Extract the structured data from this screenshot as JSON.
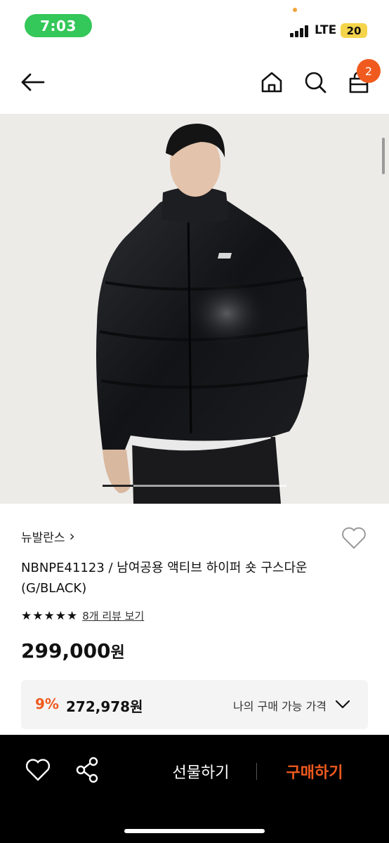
{
  "status_bar": {
    "time": "7:03",
    "network": "LTE",
    "battery": "20"
  },
  "header": {
    "cart_count": "2"
  },
  "product": {
    "brand": "뉴발란스",
    "brand_chevron": "›",
    "title": "NBNPE41123 / 남여공용 액티브 하이퍼 숏 구스다운 (G/BLACK)",
    "stars": "★★★★★",
    "review_link": "8개 리뷰 보기",
    "price": "299,000",
    "price_unit": "원"
  },
  "discount": {
    "percent": "9%",
    "price": "272,978원",
    "label": "나의 구매 가능 가격"
  },
  "bottom_bar": {
    "gift_label": "선물하기",
    "buy_label": "구매하기"
  },
  "colors": {
    "accent": "#f05a1e",
    "status_pill": "#34c759",
    "battery": "#f4d44a"
  },
  "icons": [
    "back-arrow-icon",
    "home-icon",
    "search-icon",
    "cart-icon",
    "heart-icon",
    "share-icon",
    "chevron-down-icon"
  ]
}
